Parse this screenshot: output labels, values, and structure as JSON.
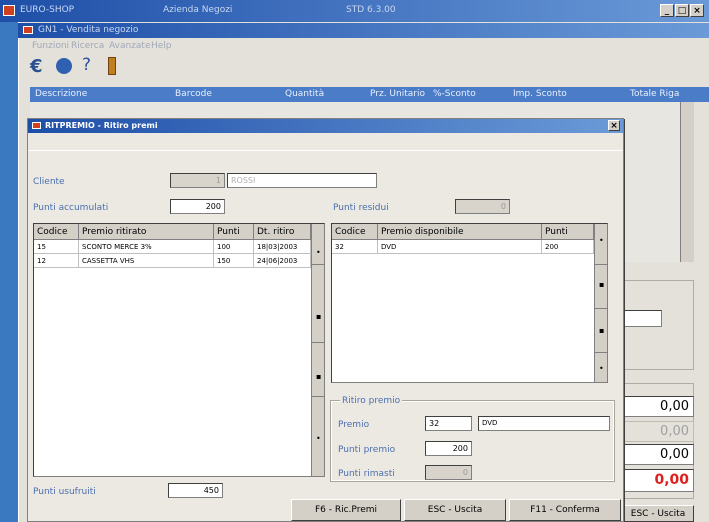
{
  "outer_window": {
    "title_left": "EURO-SHOP",
    "title_center": "Azienda Negozi",
    "title_right": "STD 6.3.00",
    "controls": [
      "_",
      "□",
      "×"
    ]
  },
  "inner_window": {
    "title": "GN1 - Vendita negozio",
    "menu": [
      "Funzioni",
      "Ricerca",
      "Avanzate",
      "Help"
    ],
    "grid_headers": [
      "Descrizione",
      "Barcode",
      "Quantità",
      "Prz. Unitario",
      "%-Sconto",
      "Imp. Sconto",
      "Totale Riga"
    ],
    "totals": [
      "0,00",
      "0,00",
      "0,00",
      "0,00"
    ],
    "esc_label": "ESC - Uscita"
  },
  "dialog": {
    "title": "RITPREMIO - Ritiro premi",
    "close": "×",
    "cliente_label": "Cliente",
    "cliente_code": "1",
    "cliente_name": "ROSSI",
    "punti_accumulati_label": "Punti accumulati",
    "punti_accumulati_value": "200",
    "punti_residui_label": "Punti residui",
    "punti_residui_value": "0",
    "ritirati_table": {
      "headers": [
        "Codice",
        "Premio ritirato",
        "Punti",
        "Dt. ritiro"
      ],
      "rows": [
        [
          "15",
          "SCONTO MERCE 3%",
          "100",
          "18|03|2003"
        ],
        [
          "12",
          "CASSETTA VHS",
          "150",
          "24|06|2003"
        ]
      ]
    },
    "disponibili_table": {
      "headers": [
        "Codice",
        "Premio disponibile",
        "Punti"
      ],
      "rows": [
        [
          "32",
          "DVD",
          "200"
        ]
      ]
    },
    "ritiro_group": {
      "title": "Ritiro premio",
      "premio_label": "Premio",
      "premio_code": "32",
      "premio_name": "DVD",
      "punti_premio_label": "Punti premio",
      "punti_premio_value": "200",
      "punti_rimasti_label": "Punti rimasti",
      "punti_rimasti_value": "0"
    },
    "punti_usufruiti_label": "Punti usufruiti",
    "punti_usufruiti_value": "450",
    "buttons": {
      "ric_premi": "F6 - Ric.Premi",
      "uscita": "ESC - Uscita",
      "conferma": "F11 - Conferma"
    }
  },
  "toolbar_icons": [
    "euro-icon",
    "diamond-nav-icon",
    "help-icon",
    "exit-door-icon"
  ],
  "colors": {
    "title_start": "#1e4fa8",
    "title_end": "#6b9ad8",
    "grid_header": "#4a7cc8",
    "dialog_bg": "#ece9e2",
    "total_red": "#e02020"
  }
}
